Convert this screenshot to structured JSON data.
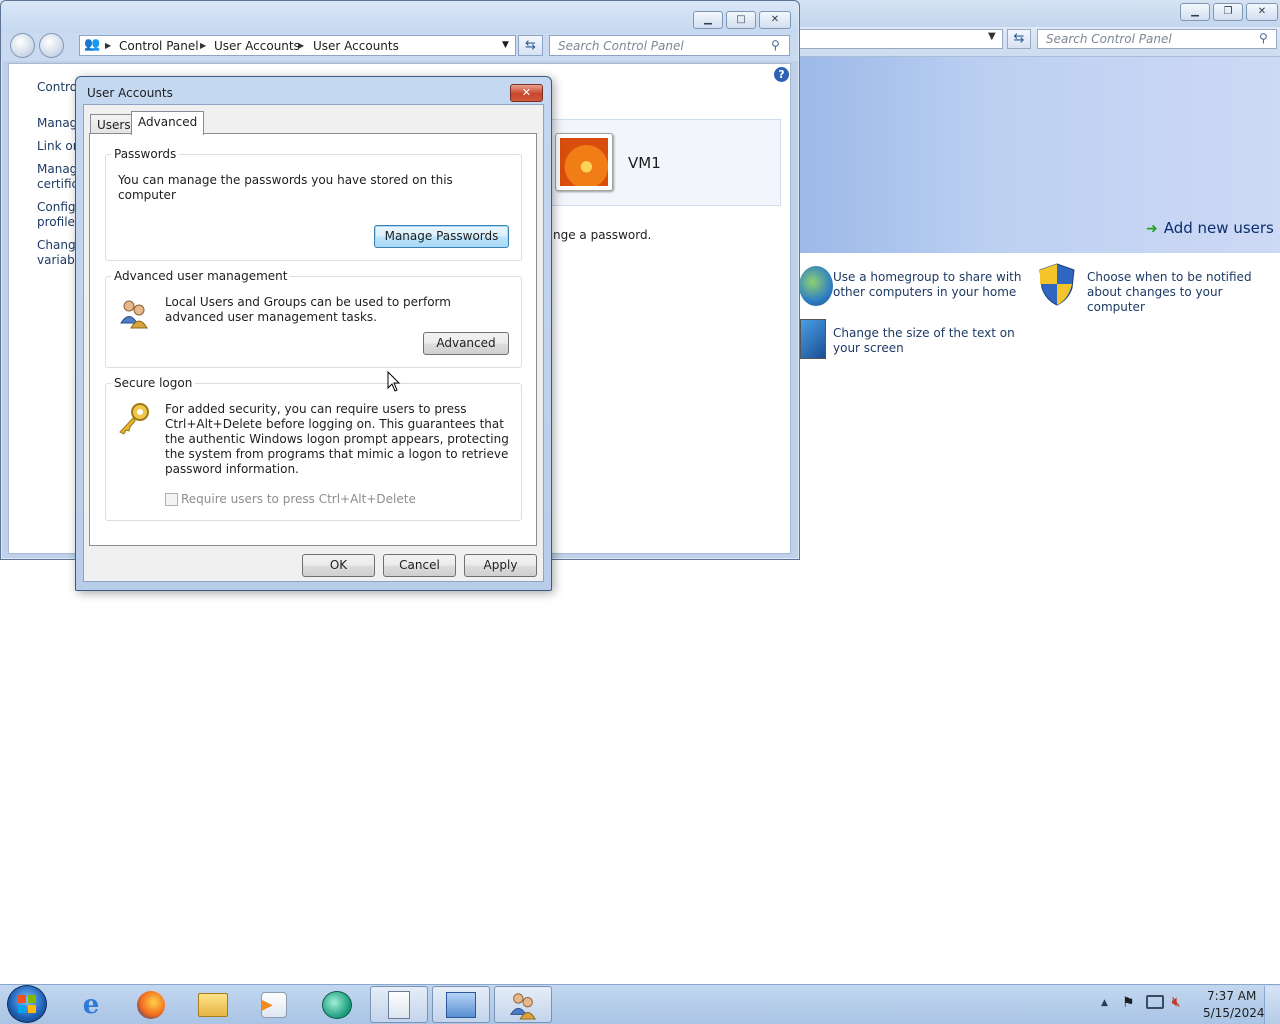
{
  "background_window": {
    "search_placeholder": "Search Control Panel",
    "add_new_users": "Add new users",
    "tasks": [
      {
        "label": "Use a homegroup to share with other computers in your home",
        "icon": "homegroup-icon"
      },
      {
        "label": "Choose when to be notified about changes to your computer",
        "icon": "uac-shield-icon"
      },
      {
        "label": "Change the size of the text on your screen",
        "icon": "display-icon"
      }
    ]
  },
  "control_panel_window": {
    "breadcrumb": [
      "Control Panel",
      "User Accounts",
      "User Accounts"
    ],
    "search_placeholder": "Search Control Panel",
    "sidebar_links": [
      "Contro",
      "Manag",
      "Link on",
      "Manag certific",
      "Config profile",
      "Change variable"
    ],
    "user_name": "VM1",
    "partial_text": "nge a password."
  },
  "dialog": {
    "title": "User Accounts",
    "tabs": [
      "Users",
      "Advanced"
    ],
    "active_tab": "Advanced",
    "passwords": {
      "label": "Passwords",
      "text": "You can manage the passwords you have stored on this computer",
      "button": "Manage Passwords"
    },
    "advanced_user_management": {
      "label": "Advanced user management",
      "text": "Local Users and Groups can be used to perform advanced user management tasks.",
      "button": "Advanced"
    },
    "secure_logon": {
      "label": "Secure logon",
      "text": "For added security, you can require users to press Ctrl+Alt+Delete before logging on. This guarantees that the authentic Windows logon prompt appears, protecting the system from programs that mimic a logon to retrieve password information.",
      "checkbox_label": "Require users to press Ctrl+Alt+Delete",
      "checkbox_checked": false,
      "checkbox_enabled": false
    },
    "buttons": {
      "ok": "OK",
      "cancel": "Cancel",
      "apply": "Apply"
    }
  },
  "taskbar": {
    "items": [
      "internet-explorer-icon",
      "firefox-icon",
      "file-explorer-icon",
      "media-player-icon",
      "app-icon",
      "documents-icon",
      "control-panel-icon",
      "user-accounts-icon"
    ],
    "clock_time": "7:37 AM",
    "clock_date": "5/15/2024"
  }
}
